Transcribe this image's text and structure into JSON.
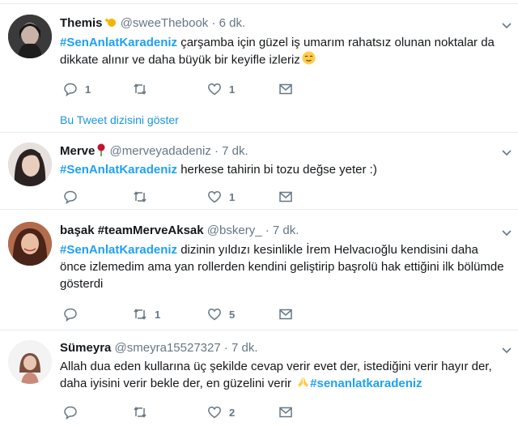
{
  "tweets": [
    {
      "name": "Themis",
      "handle": "@sweeThebook",
      "time": "· 6 dk.",
      "hashtag": "#SenAnlatKaradeniz",
      "text": " çarşamba için güzel iş umarım rahatsız olunan noktalar da dikkate alınır ve daha büyük bir keyifle izleriz",
      "replies": "1",
      "retweets": "",
      "likes": "1",
      "thread_link": "Bu Tweet dizisini göster"
    },
    {
      "name": "Merve",
      "handle": "@merveyadadeniz",
      "time": "· 7 dk.",
      "hashtag": "#SenAnlatKaradeniz",
      "text": " herkese tahirin bi tozu değse yeter :)",
      "replies": "",
      "retweets": "",
      "likes": "1"
    },
    {
      "name": "başak #teamMerveAksak",
      "handle": "@bskery_",
      "time": "· 7 dk.",
      "hashtag": "#SenAnlatKaradeniz",
      "text": " dizinin yıldızı kesinlikle İrem Helvacıoğlu kendisini daha önce izlemedim ama yan rollerden kendini geliştirip başrolü hak ettiğini ilk bölümde gösterdi",
      "replies": "",
      "retweets": "1",
      "likes": "5"
    },
    {
      "name": "Sümeyra",
      "handle": "@smeyra15527327",
      "time": "· 7 dk.",
      "text": "Allah dua eden kullarına üç şekilde cevap verir evet der, istediğini verir hayır der, daha iyisini verir bekle der, en güzelini verir ",
      "hashtag_end": "#senanlatkaradeniz",
      "replies": "",
      "retweets": "",
      "likes": "2"
    }
  ],
  "colors": {
    "accent": "#1da1f2",
    "muted": "#657786"
  }
}
